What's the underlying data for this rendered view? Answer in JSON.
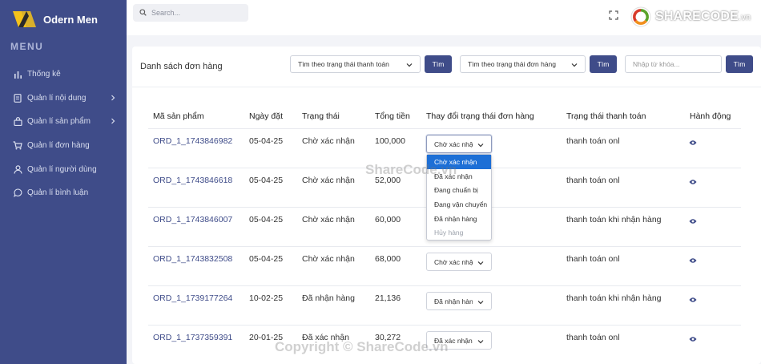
{
  "sidebar": {
    "brand": "Odern Men",
    "menu_title": "MENU",
    "items": [
      {
        "label": "Thống kê",
        "icon": "bar-chart-icon"
      },
      {
        "label": "Quản lí nội dung",
        "icon": "document-icon"
      },
      {
        "label": "Quản lí sản phẩm",
        "icon": "bag-icon"
      },
      {
        "label": "Quản lí đơn hàng",
        "icon": "cart-icon"
      },
      {
        "label": "Quản lí người dùng",
        "icon": "user-icon"
      },
      {
        "label": "Quản lí bình luận",
        "icon": "comment-icon"
      }
    ]
  },
  "topbar": {
    "search_placeholder": "Search...",
    "logo_text": "SHARECODE",
    "logo_domain": ".vn"
  },
  "card": {
    "title": "Danh sách đơn hàng",
    "filter_payment": "Tìm theo trạng thái thanh toán",
    "filter_order": "Tìm theo trạng thái đơn hàng",
    "btn_search": "Tìm",
    "keyword_placeholder": "Nhập từ khóa..."
  },
  "table": {
    "headers": [
      "Mã sản phẩm",
      "Ngày đặt",
      "Trạng thái",
      "Tổng tiền",
      "Thay đổi trạng thái đơn hàng",
      "Trạng thái thanh toán",
      "Hành động"
    ],
    "rows": [
      {
        "code": "ORD_1_1743846982",
        "date": "05-04-25",
        "status": "Chờ xác nhận",
        "total": "100,000",
        "select": "Chờ xác nhận",
        "payment": "thanh toán onl"
      },
      {
        "code": "ORD_1_1743846618",
        "date": "05-04-25",
        "status": "Chờ xác nhận",
        "total": "52,000",
        "select": "",
        "payment": "thanh toán onl"
      },
      {
        "code": "ORD_1_1743846007",
        "date": "05-04-25",
        "status": "Chờ xác nhận",
        "total": "60,000",
        "select": "",
        "payment": "thanh toán khi nhận hàng"
      },
      {
        "code": "ORD_1_1743832508",
        "date": "05-04-25",
        "status": "Chờ xác nhận",
        "total": "68,000",
        "select": "Chờ xác nhận",
        "payment": "thanh toán onl"
      },
      {
        "code": "ORD_1_1739177264",
        "date": "10-02-25",
        "status": "Đã nhận hàng",
        "total": "21,136",
        "select": "Đã nhận hàng",
        "payment": "thanh toán khi nhận hàng"
      },
      {
        "code": "ORD_1_1737359391",
        "date": "20-01-25",
        "status": "Đã xác nhận",
        "total": "30,272",
        "select": "Đã xác nhận",
        "payment": "thanh toán onl"
      }
    ]
  },
  "dropdown": {
    "options": [
      "Chờ xác nhận",
      "Đã xác nhận",
      "Đang chuẩn bị",
      "Đang vận chuyển",
      "Đã nhận hàng",
      "Hủy hàng"
    ],
    "selected_index": 0,
    "disabled_index": 5
  },
  "watermarks": {
    "center": "ShareCode.vn",
    "bottom": "Copyright © ShareCode.vn"
  },
  "colors": {
    "sidebar": "#3f4c89",
    "accent": "#3f4c89",
    "dropdown_active": "#1d6fd6"
  }
}
